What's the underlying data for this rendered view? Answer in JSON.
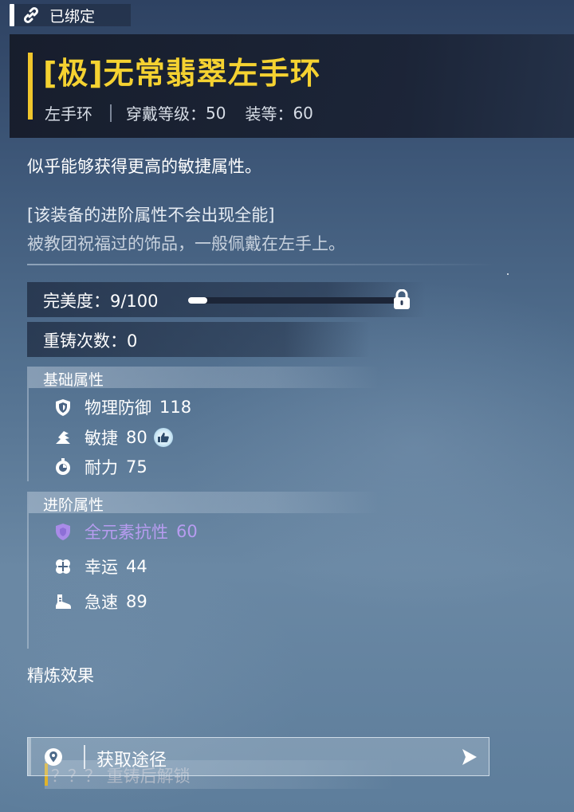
{
  "bound_tag": {
    "label": "已绑定",
    "icon": "link-icon"
  },
  "item": {
    "name": "[极]无常翡翠左手环",
    "slot": "左手环",
    "level_req_label": "穿戴等级：",
    "level_req": "50",
    "gear_score_label": "装等：",
    "gear_score": "60",
    "name_color": "#f5d231"
  },
  "description": {
    "line1": "似乎能够获得更高的敏捷属性。",
    "line2": "[该装备的进阶属性不会出现全能]",
    "line3": "被教团祝福过的饰品，一般佩戴在左手上。"
  },
  "perfection": {
    "label": "完美度：",
    "value_text": "9/100",
    "progress": 0.09,
    "locked": true,
    "lock_icon": "lock-icon"
  },
  "reforge": {
    "label": "重铸次数：",
    "count": "0"
  },
  "base_attributes": {
    "title": "基础属性",
    "items": [
      {
        "icon": "shield-icon",
        "name": "物理防御",
        "value": "118"
      },
      {
        "icon": "agility-icon",
        "name": "敏捷",
        "value": "80",
        "badge": "thumbs-up-icon"
      },
      {
        "icon": "endurance-icon",
        "name": "耐力",
        "value": "75"
      }
    ]
  },
  "advanced_attributes": {
    "title": "进阶属性",
    "items": [
      {
        "icon": "element-shield-icon",
        "name": "全元素抗性",
        "value": "60",
        "color": "#b79cf0"
      },
      {
        "icon": "clover-icon",
        "name": "幸运",
        "value": "44"
      },
      {
        "icon": "boot-icon",
        "name": "急速",
        "value": "89"
      }
    ],
    "locked_text": "？？？ 重铸后解锁"
  },
  "refine": {
    "title": "精炼效果"
  },
  "acquire": {
    "label": "获取途径",
    "icon": "location-pin-icon",
    "arrow": "arrow-right-icon"
  },
  "colors": {
    "accent_gold": "#f0c62c",
    "purple": "#b79cf0"
  }
}
